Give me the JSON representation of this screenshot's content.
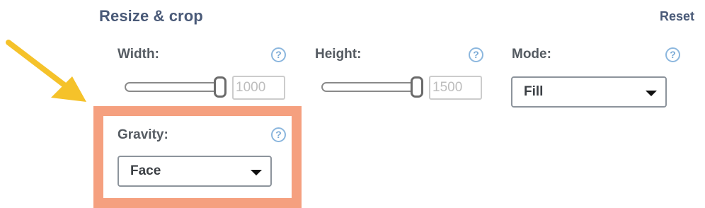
{
  "section": {
    "title": "Resize & crop",
    "reset_label": "Reset"
  },
  "fields": {
    "width": {
      "label": "Width:",
      "value": "1000",
      "help": "?"
    },
    "height": {
      "label": "Height:",
      "value": "1500",
      "help": "?"
    },
    "mode": {
      "label": "Mode:",
      "selected": "Fill",
      "help": "?"
    },
    "gravity": {
      "label": "Gravity:",
      "selected": "Face",
      "help": "?"
    }
  },
  "colors": {
    "accent_text": "#4a5a78",
    "help_icon": "#7aaad6",
    "highlight": "#f5a07f",
    "arrow": "#f5c22a"
  },
  "icons": {
    "help": "question-circle-icon",
    "dropdown": "caret-down-icon",
    "annotation": "arrow-icon"
  }
}
